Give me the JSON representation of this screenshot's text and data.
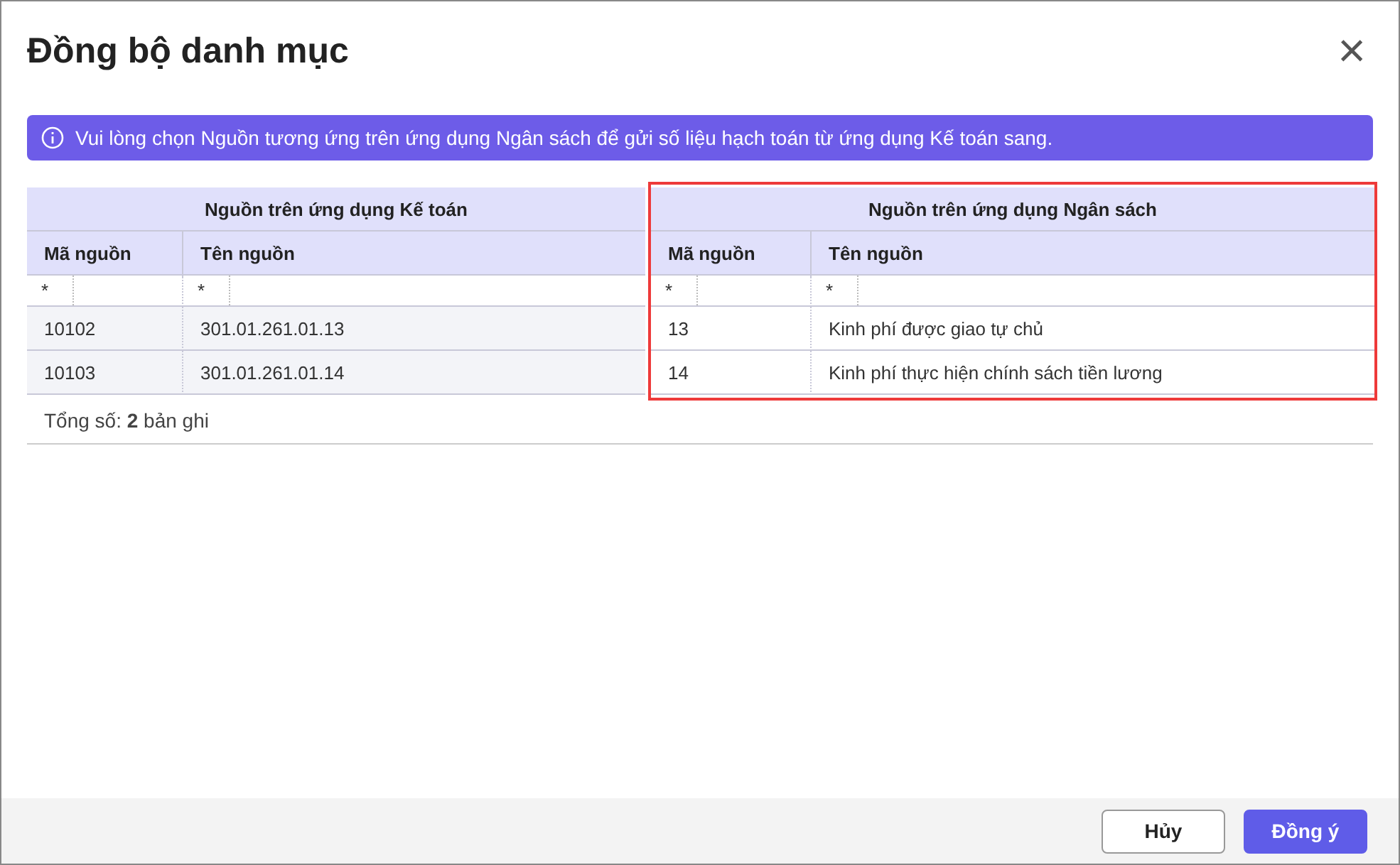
{
  "dialog": {
    "title": "Đồng bộ danh mục",
    "close": "×"
  },
  "notice": {
    "text": "Vui lòng chọn Nguồn tương ứng trên ứng dụng Ngân sách để gửi số liệu hạch toán từ ứng dụng Kế toán sang."
  },
  "groups": [
    {
      "title": "Nguồn trên ứng dụng Kế toán",
      "highlighted": false,
      "columns": [
        "Mã nguồn",
        "Tên nguồn"
      ],
      "filters": [
        "*",
        "*"
      ],
      "rows": [
        [
          "10102",
          "301.01.261.01.13"
        ],
        [
          "10103",
          "301.01.261.01.14"
        ]
      ]
    },
    {
      "title": "Nguồn trên ứng dụng Ngân sách",
      "highlighted": true,
      "columns": [
        "Mã nguồn",
        "Tên nguồn"
      ],
      "filters": [
        "*",
        "*"
      ],
      "rows": [
        [
          "13",
          "Kinh phí được giao tự chủ"
        ],
        [
          "14",
          "Kinh phí thực hiện chính sách tiền lương"
        ]
      ]
    }
  ],
  "summary": {
    "text": "Tổng số: **2** bản ghi"
  },
  "buttons": [
    {
      "label": "Hủy",
      "kind": "secondary"
    },
    {
      "label": "Đồng ý",
      "kind": "primary"
    }
  ]
}
